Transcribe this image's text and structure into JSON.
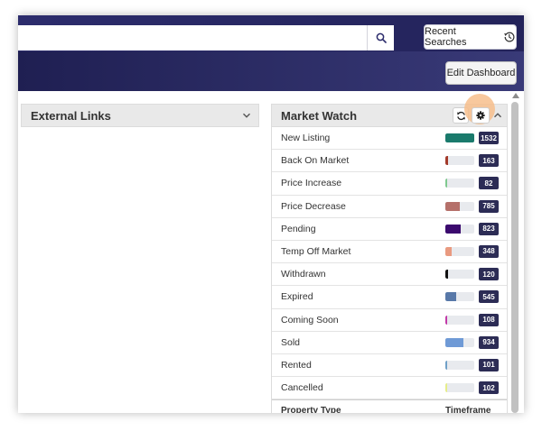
{
  "header": {
    "search": {
      "placeholder": "",
      "value": ""
    },
    "search_icon": "search-icon",
    "recent_searches_label": "Recent Searches",
    "recent_icon": "history-icon",
    "edit_dashboard_label": "Edit Dashboard"
  },
  "external_links": {
    "title": "External Links"
  },
  "market_watch": {
    "title": "Market Watch",
    "items": [
      {
        "label": "New Listing",
        "count": "1532",
        "color": "#1a7a6c",
        "fill": 1.0
      },
      {
        "label": "Back On Market",
        "count": "163",
        "color": "#a33a2a",
        "fill": 0.1
      },
      {
        "label": "Price Increase",
        "count": "82",
        "color": "#7fc98f",
        "fill": 0.05
      },
      {
        "label": "Price Decrease",
        "count": "785",
        "color": "#b5706a",
        "fill": 0.51
      },
      {
        "label": "Pending",
        "count": "823",
        "color": "#3b0a6e",
        "fill": 0.54
      },
      {
        "label": "Temp Off Market",
        "count": "348",
        "color": "#e99a80",
        "fill": 0.23
      },
      {
        "label": "Withdrawn",
        "count": "120",
        "color": "#111111",
        "fill": 0.08
      },
      {
        "label": "Expired",
        "count": "545",
        "color": "#5878a8",
        "fill": 0.36
      },
      {
        "label": "Coming Soon",
        "count": "108",
        "color": "#c23aa8",
        "fill": 0.07
      },
      {
        "label": "Sold",
        "count": "934",
        "color": "#6f9ad6",
        "fill": 0.61
      },
      {
        "label": "Rented",
        "count": "101",
        "color": "#6fa0c8",
        "fill": 0.07
      },
      {
        "label": "Cancelled",
        "count": "102",
        "color": "#e6ee8a",
        "fill": 0.07
      }
    ],
    "footer": {
      "property_type_label": "Property Type",
      "timeframe_label": "Timeframe"
    }
  }
}
